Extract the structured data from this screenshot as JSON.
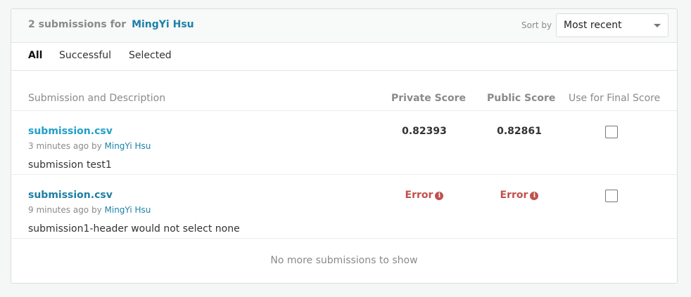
{
  "header": {
    "count_text": "2 submissions for",
    "user_name": "MingYi Hsu",
    "sort_label": "Sort by",
    "sort_value": "Most recent"
  },
  "tabs": [
    {
      "label": "All",
      "active": true
    },
    {
      "label": "Successful",
      "active": false
    },
    {
      "label": "Selected",
      "active": false
    }
  ],
  "columns": {
    "description": "Submission and Description",
    "private_score": "Private Score",
    "public_score": "Public Score",
    "final_score": "Use for Final Score"
  },
  "submissions": [
    {
      "file": "submission.csv",
      "time": "3 minutes ago by",
      "user": "MingYi Hsu",
      "description": "submission test1",
      "private_score": "0.82393",
      "public_score": "0.82861",
      "selected": false
    },
    {
      "file": "submission.csv",
      "time": "9 minutes ago by",
      "user": "MingYi Hsu",
      "description": "submission1-header would not select none",
      "private_score": "Error",
      "public_score": "Error",
      "selected": false
    }
  ],
  "footer": {
    "message": "No more submissions to show"
  },
  "colors": {
    "link": "#1c82a8",
    "error": "#c0504d"
  },
  "icons": {
    "error_info": "info-circle-icon"
  }
}
